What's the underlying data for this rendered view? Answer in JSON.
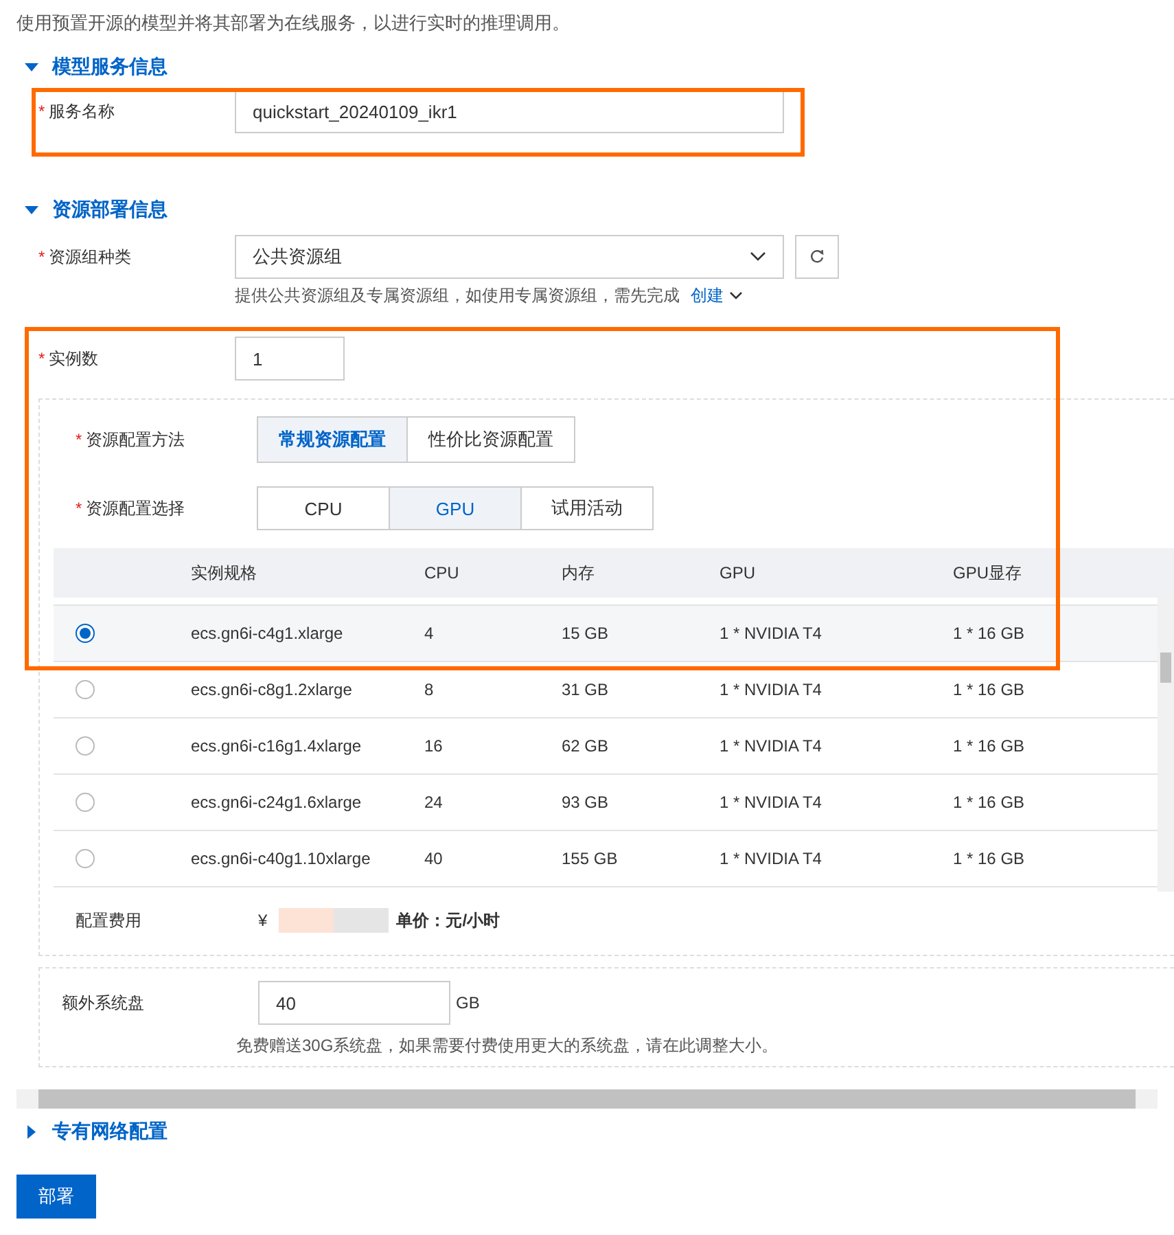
{
  "description": "使用预置开源的模型并将其部署为在线服务，以进行实时的推理调用。",
  "model_section": {
    "title": "模型服务信息",
    "expanded": true,
    "service_name": {
      "label": "服务名称",
      "mark": "*",
      "value": "quickstart_20240109_ikr1"
    }
  },
  "resource_section": {
    "title": "资源部署信息",
    "expanded": true,
    "resource_group": {
      "label": "资源组种类",
      "mark": "*",
      "value": "公共资源组",
      "hint": "提供公共资源组及专属资源组，如使用专属资源组，需先完成",
      "link": "创建"
    },
    "instance_count": {
      "label": "实例数",
      "mark": "*",
      "value": "1"
    },
    "config_method": {
      "label": "资源配置方法",
      "mark": "*",
      "options": [
        {
          "label": "常规资源配置",
          "selected": true
        },
        {
          "label": "性价比资源配置",
          "selected": false
        }
      ]
    },
    "config_choice": {
      "label": "资源配置选择",
      "mark": "*",
      "options": [
        {
          "label": "CPU",
          "selected": false
        },
        {
          "label": "GPU",
          "selected": true
        },
        {
          "label": "试用活动",
          "selected": false
        }
      ]
    },
    "table": {
      "columns": [
        "实例规格",
        "CPU",
        "内存",
        "GPU",
        "GPU显存"
      ],
      "rows": [
        {
          "selected": true,
          "spec": "ecs.gn6i-c4g1.xlarge",
          "cpu": "4",
          "memory": "15 GB",
          "gpu": "1 * NVIDIA T4",
          "gpu_memory": "1 * 16 GB"
        },
        {
          "selected": false,
          "spec": "ecs.gn6i-c8g1.2xlarge",
          "cpu": "8",
          "memory": "31 GB",
          "gpu": "1 * NVIDIA T4",
          "gpu_memory": "1 * 16 GB"
        },
        {
          "selected": false,
          "spec": "ecs.gn6i-c16g1.4xlarge",
          "cpu": "16",
          "memory": "62 GB",
          "gpu": "1 * NVIDIA T4",
          "gpu_memory": "1 * 16 GB"
        },
        {
          "selected": false,
          "spec": "ecs.gn6i-c24g1.6xlarge",
          "cpu": "24",
          "memory": "93 GB",
          "gpu": "1 * NVIDIA T4",
          "gpu_memory": "1 * 16 GB"
        },
        {
          "selected": false,
          "spec": "ecs.gn6i-c40g1.10xlarge",
          "cpu": "40",
          "memory": "155 GB",
          "gpu": "1 * NVIDIA T4",
          "gpu_memory": "1 * 16 GB"
        }
      ]
    },
    "cost": {
      "label": "配置费用",
      "currency": "¥",
      "unit": "单价：元/小时"
    },
    "extra_disk": {
      "label": "额外系统盘",
      "value": "40",
      "unit": "GB",
      "hint": "免费赠送30G系统盘，如果需要付费使用更大的系统盘，请在此调整大小。"
    }
  },
  "network_section": {
    "title": "专有网络配置",
    "expanded": false
  },
  "deploy_button": "部署"
}
